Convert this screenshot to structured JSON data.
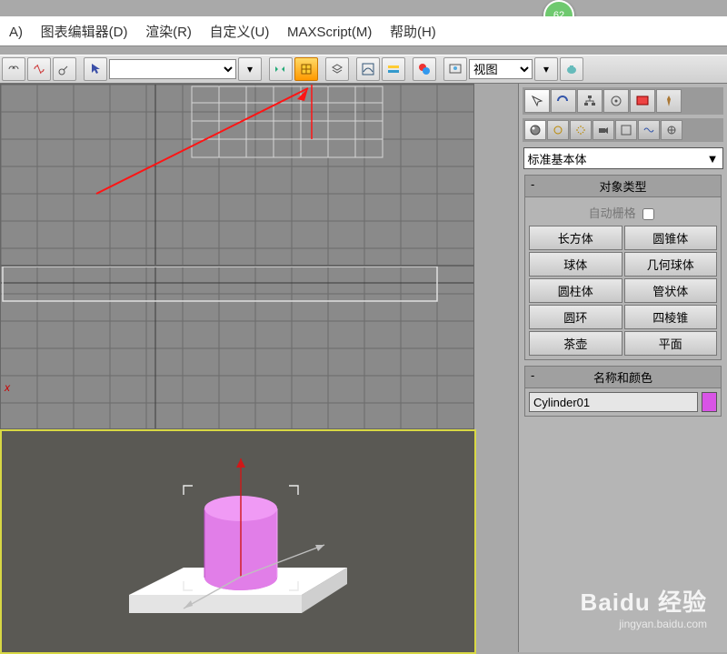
{
  "badge": "62",
  "menu": {
    "a": "A)",
    "chart": "图表编辑器(D)",
    "render": "渲染(R)",
    "custom": "自定义(U)",
    "max": "MAXScript(M)",
    "help": "帮助(H)"
  },
  "toolbar": {
    "view_sel": "视图"
  },
  "axis": {
    "x": "x"
  },
  "panel": {
    "primitive_dd": "标准基本体",
    "object_type_title": "对象类型",
    "auto_grid": "自动栅格",
    "buttons": {
      "box": "长方体",
      "cone": "圆锥体",
      "sphere": "球体",
      "geosphere": "几何球体",
      "cylinder": "圆柱体",
      "tube": "管状体",
      "torus": "圆环",
      "pyramid": "四棱锥",
      "teapot": "茶壶",
      "plane": "平面"
    },
    "name_color_title": "名称和颜色",
    "obj_name": "Cylinder01"
  },
  "watermark": {
    "brand": "Baidu 经验",
    "url": "jingyan.baidu.com"
  }
}
